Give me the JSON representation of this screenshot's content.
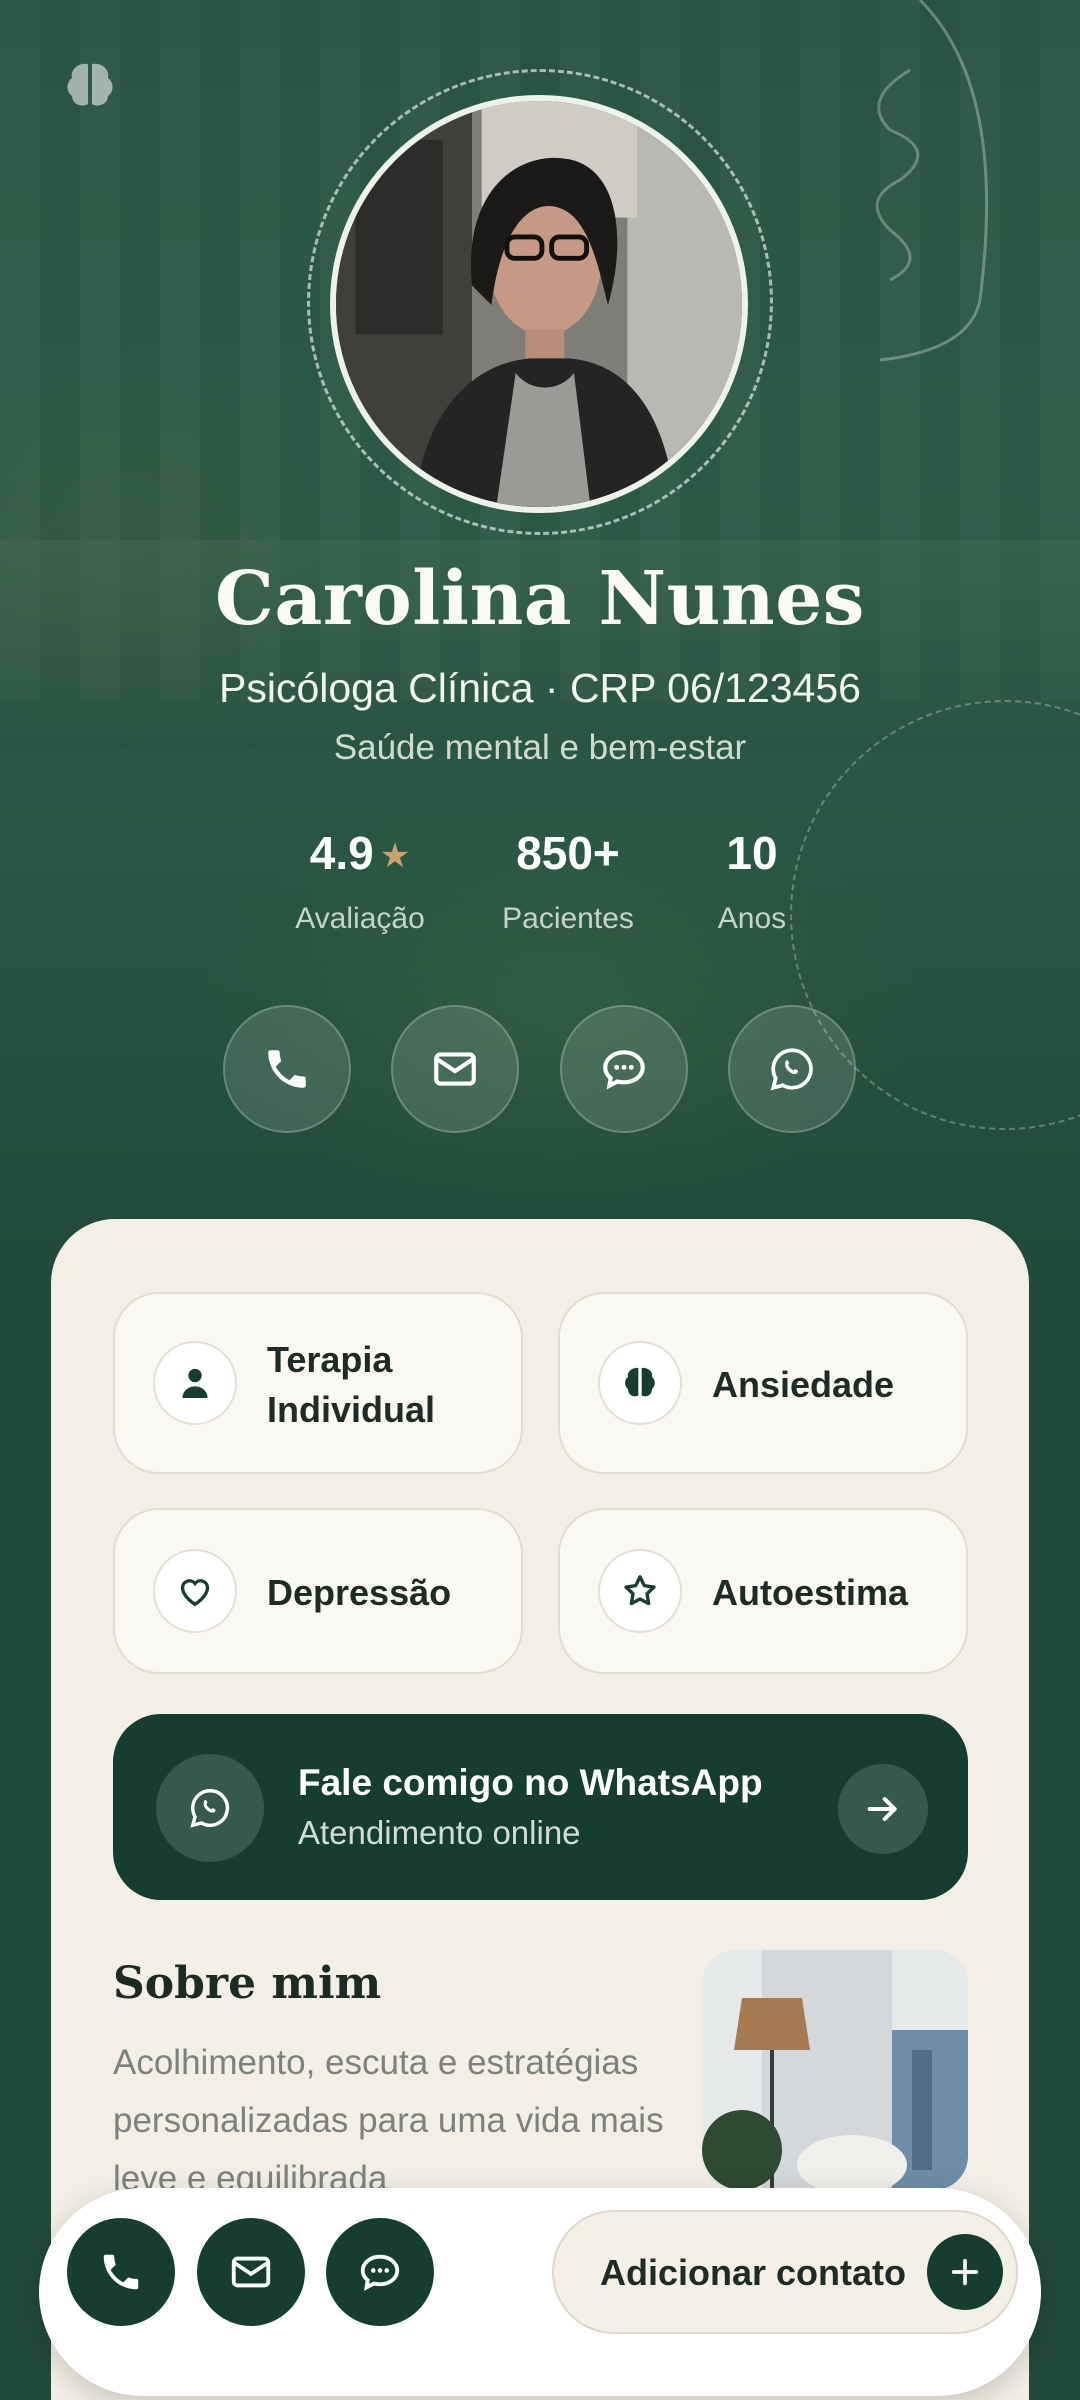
{
  "profile": {
    "name": "Carolina Nunes",
    "subtitle": "Psicóloga Clínica · CRP 06/123456",
    "tagline": "Saúde mental e bem-estar"
  },
  "stats": [
    {
      "value": "4.9",
      "label": "Avaliação",
      "icon": "star-icon"
    },
    {
      "value": "850+",
      "label": "Pacientes"
    },
    {
      "value": "10",
      "label": "Anos"
    }
  ],
  "contact_buttons": [
    "phone-icon",
    "mail-icon",
    "chat-icon",
    "whatsapp-icon"
  ],
  "specialties": [
    {
      "label": "Terapia Individual",
      "icon": "person-icon"
    },
    {
      "label": "Ansiedade",
      "icon": "brain-icon"
    },
    {
      "label": "Depressão",
      "icon": "heart-icon"
    },
    {
      "label": "Autoestima",
      "icon": "star-outline-icon"
    }
  ],
  "whatsapp_banner": {
    "title": "Fale comigo no WhatsApp",
    "subtitle": "Atendimento online",
    "icon": "whatsapp-icon",
    "action_icon": "arrow-right-icon"
  },
  "about": {
    "title": "Sobre mim",
    "text": "Acolhimento, escuta e estratégias personalizadas para uma vida mais leve e equilibrada"
  },
  "bottom_bar": {
    "buttons": [
      "phone-icon",
      "mail-icon",
      "chat-icon"
    ],
    "add_contact_label": "Adicionar contato",
    "add_icon": "plus-icon"
  },
  "colors": {
    "hero_green": "#2b5445",
    "dark_green": "#173d30",
    "card_cream": "#f3efe6",
    "star_gold": "#c6a46b"
  }
}
